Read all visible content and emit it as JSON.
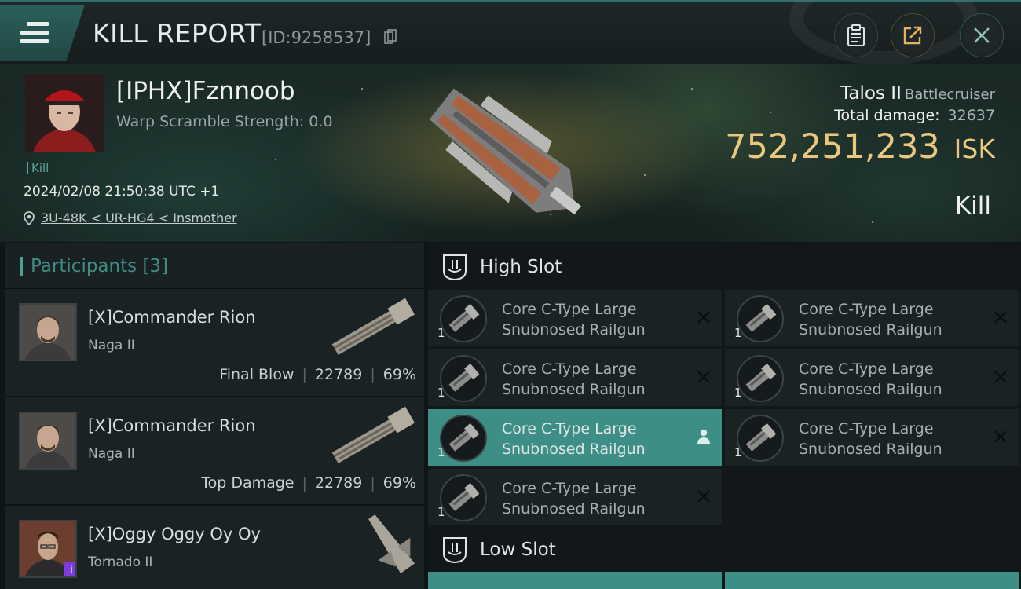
{
  "header": {
    "title": "KILL REPORT",
    "id_text": "[ID:9258537]",
    "menu_icon": "hamburger-menu-icon",
    "buttons": [
      "clipboard-icon",
      "share-icon",
      "close-icon"
    ]
  },
  "victim": {
    "name": "[IPHX]Fznnoob",
    "warp_scramble": "Warp Scramble Strength: 0.0",
    "tag": "Kill",
    "datetime": "2024/02/08 21:50:38 UTC +1",
    "location": "3U-48K < UR-HG4 < Insmother",
    "ship_name": "Talos II",
    "ship_class": "Battlecruiser",
    "total_damage_label": "Total damage:",
    "total_damage": "32637",
    "isk_value": "752,251,233",
    "isk_unit": "ISK",
    "result": "Kill"
  },
  "participants": {
    "title": "Participants [3]",
    "rows": [
      {
        "name": "[X]Commander Rion",
        "ship": "Naga II",
        "role": "Final Blow",
        "damage": "22789",
        "percent": "69%"
      },
      {
        "name": "[X]Commander Rion",
        "ship": "Naga II",
        "role": "Top Damage",
        "damage": "22789",
        "percent": "69%"
      },
      {
        "name": "[X]Oggy Oggy Oy Oy",
        "ship": "Tornado II",
        "role": "",
        "damage": "",
        "percent": ""
      }
    ]
  },
  "slots": {
    "high_label": "High Slot",
    "low_label": "Low Slot",
    "high_modules": [
      {
        "qty": "1",
        "line1": "Core C-Type Large",
        "line2": "Snubnosed Railgun",
        "state": "destroyed"
      },
      {
        "qty": "1",
        "line1": "Core C-Type Large",
        "line2": "Snubnosed Railgun",
        "state": "destroyed"
      },
      {
        "qty": "1",
        "line1": "Core C-Type Large",
        "line2": "Snubnosed Railgun",
        "state": "destroyed"
      },
      {
        "qty": "1",
        "line1": "Core C-Type Large",
        "line2": "Snubnosed Railgun",
        "state": "destroyed"
      },
      {
        "qty": "1",
        "line1": "Core C-Type Large",
        "line2": "Snubnosed Railgun",
        "state": "dropped"
      },
      {
        "qty": "1",
        "line1": "Core C-Type Large",
        "line2": "Snubnosed Railgun",
        "state": "destroyed"
      },
      {
        "qty": "1",
        "line1": "Core C-Type Large",
        "line2": "Snubnosed Railgun",
        "state": "destroyed"
      }
    ]
  },
  "colors": {
    "accent": "#3d8f86",
    "isk": "#e9c77e",
    "background": "#121719"
  }
}
